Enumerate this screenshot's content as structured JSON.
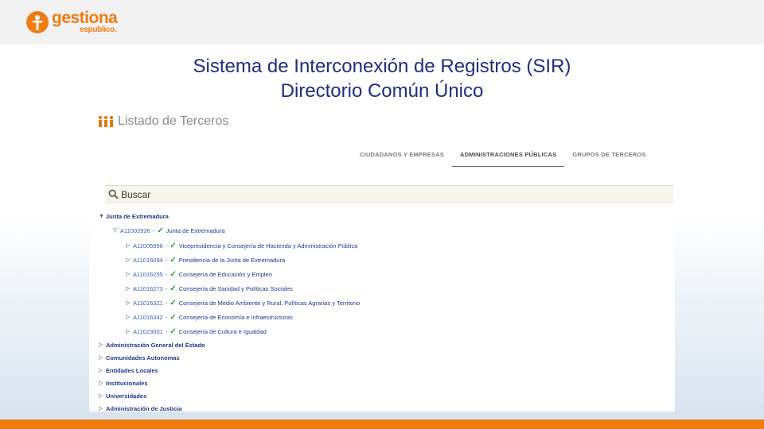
{
  "brand": {
    "logo_main": "gestiona",
    "logo_sub": "espublico.",
    "color": "#f07b13"
  },
  "slide": {
    "title_line1": "Sistema de Interconexión de Registros (SIR)",
    "title_line2": "Directorio Común Único",
    "title_color": "#1f2f7a"
  },
  "screen": {
    "heading": "Listado de Terceros",
    "tabs": [
      {
        "label": "CIUDADANOS Y EMPRESAS",
        "active": false
      },
      {
        "label": "ADMINISTRACIONES PÚBLICAS",
        "active": true
      },
      {
        "label": "GRUPOS DE TERCEROS",
        "active": false
      }
    ],
    "search": {
      "placeholder": "Buscar"
    },
    "tree": {
      "root": "Junta de Extremadura",
      "child": {
        "code": "A11002926",
        "name": "Junta de Extremadura"
      },
      "leaves": [
        {
          "code": "A11005996",
          "name": "Vicepresidencia y Consejería de Hacienda y Administración Pública"
        },
        {
          "code": "A11016094",
          "name": "Presidencia de la Junta de Extremadura"
        },
        {
          "code": "A11016255",
          "name": "Consejería de Educación y Empleo"
        },
        {
          "code": "A11016273",
          "name": "Consejería de Sanidad y Políticas Sociales"
        },
        {
          "code": "A11016321",
          "name": "Consejería de Medio Ambiente y Rural, Políticas Agrarias y Territorio"
        },
        {
          "code": "A11016342",
          "name": "Consejería de Economía e Infraestructuras"
        },
        {
          "code": "A11023001",
          "name": "Consejería de Cultura e Igualdad"
        }
      ],
      "groups": [
        "Administración General del Estado",
        "Comunidades Autonomas",
        "Entidades Locales",
        "Institucionales",
        "Universidades",
        "Administración de Justicia"
      ]
    }
  }
}
